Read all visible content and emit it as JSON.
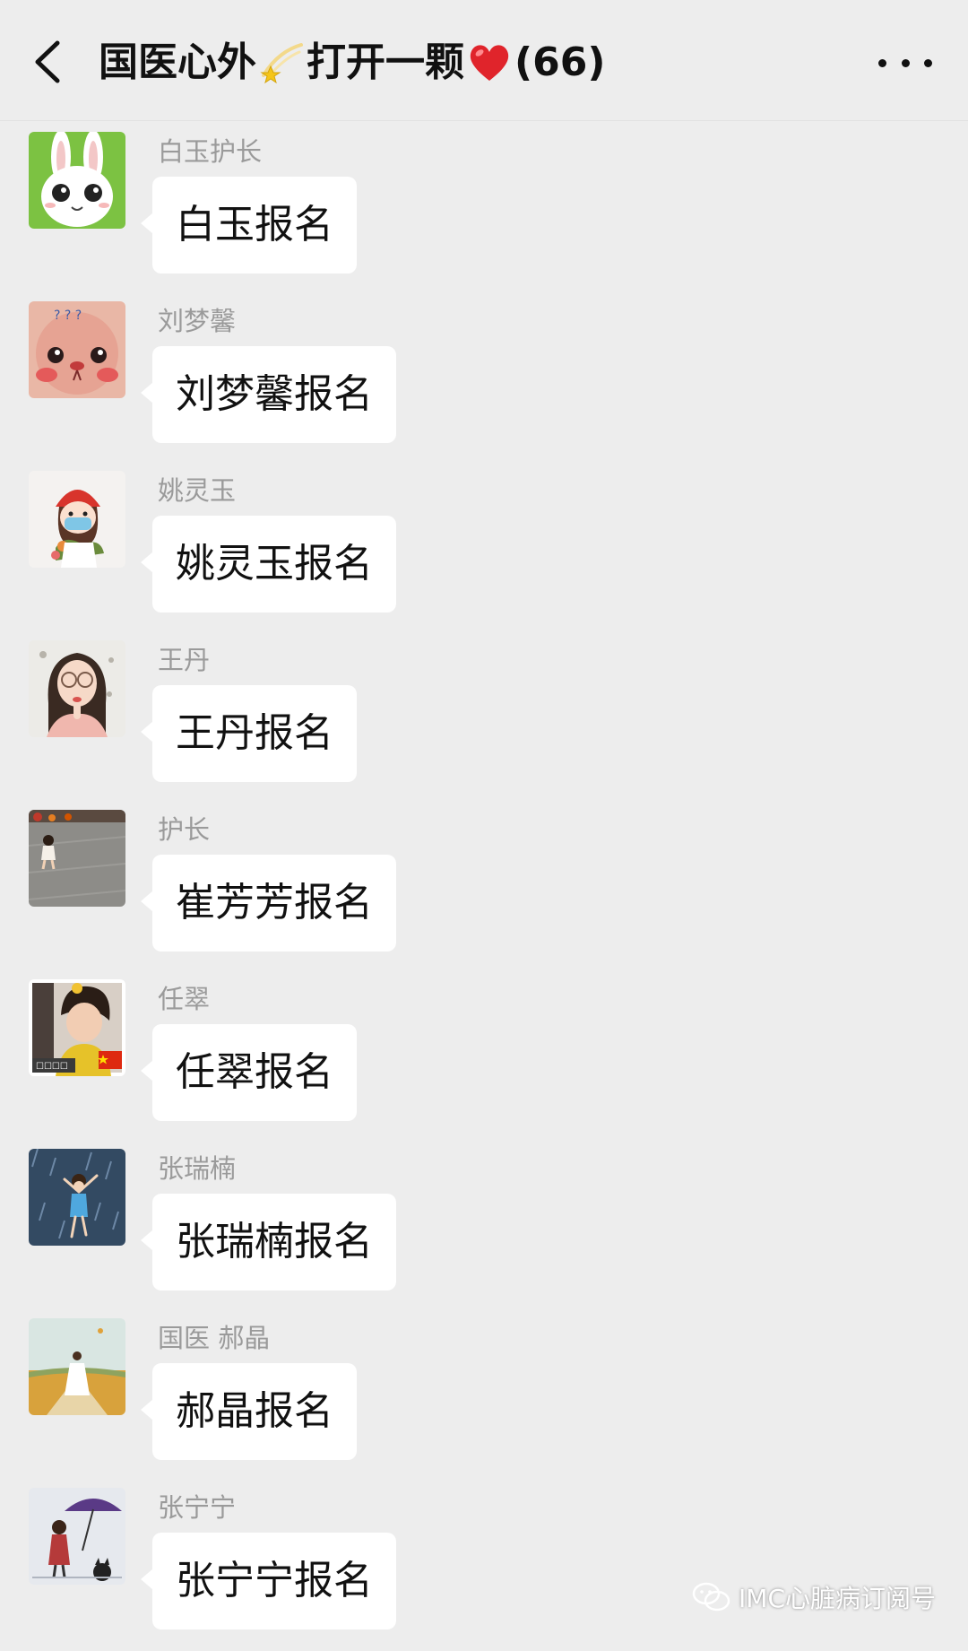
{
  "header": {
    "title_part1": "国医心外",
    "title_part2": "打开一颗",
    "title_count": "(66)",
    "icons": [
      "back-arrow-icon",
      "shooting-star-emoji",
      "red-heart-emoji",
      "more-dots-icon"
    ]
  },
  "messages": [
    {
      "sender": "白玉护长",
      "text": "白玉报名",
      "avatar": "white-rabbit-avatar"
    },
    {
      "sender": "刘梦馨",
      "text": "刘梦馨报名",
      "avatar": "pink-bear-avatar"
    },
    {
      "sender": "姚灵玉",
      "text": "姚灵玉报名",
      "avatar": "cartoon-girl-red-hat-avatar"
    },
    {
      "sender": "王丹",
      "text": "王丹报名",
      "avatar": "girl-glasses-photo-avatar"
    },
    {
      "sender": "护长",
      "text": "崔芳芳报名",
      "avatar": "child-walking-photo-avatar"
    },
    {
      "sender": "任翠",
      "text": "任翠报名",
      "avatar": "child-photo-flag-avatar"
    },
    {
      "sender": "张瑞楠",
      "text": "张瑞楠报名",
      "avatar": "dancing-girl-rain-avatar"
    },
    {
      "sender": "国医  郝晶",
      "text": "郝晶报名",
      "avatar": "girl-field-illustration-avatar"
    },
    {
      "sender": "张宁宁",
      "text": "张宁宁报名",
      "avatar": "umbrella-girl-cat-avatar"
    }
  ],
  "watermark": {
    "text": "IMC心脏病订阅号",
    "icon": "wechat-icon"
  },
  "colors": {
    "background": "#ededed",
    "bubble": "#ffffff",
    "sender": "#9a9a9a"
  }
}
